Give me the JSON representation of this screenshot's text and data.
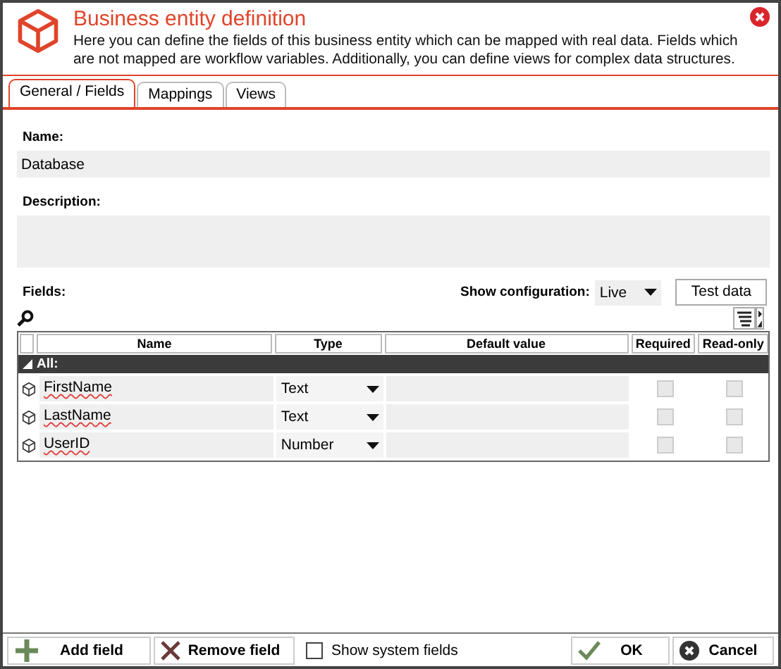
{
  "header": {
    "title": "Business entity definition",
    "description": "Here you can define the fields of this business entity which can be mapped with real data. Fields which are not mapped are workflow variables. Additionally, you can define views for complex data structures."
  },
  "tabs": [
    {
      "label": "General / Fields",
      "selected": true
    },
    {
      "label": "Mappings",
      "selected": false
    },
    {
      "label": "Views",
      "selected": false
    }
  ],
  "name": {
    "label": "Name:",
    "value": "Database"
  },
  "description": {
    "label": "Description:"
  },
  "fields": {
    "label": "Fields:",
    "config_label": "Show configuration:",
    "config_value": "Live",
    "test_button": "Test data"
  },
  "table": {
    "columns": [
      "Name",
      "Type",
      "Default value",
      "Required",
      "Read-only"
    ],
    "group": "All:",
    "group_expanded": true,
    "rows": [
      {
        "name": "FirstName",
        "type": "Text",
        "required": false,
        "read_only": false
      },
      {
        "name": "LastName",
        "type": "Text",
        "required": false,
        "read_only": false
      },
      {
        "name": "UserID",
        "type": "Number",
        "required": false,
        "read_only": false
      }
    ]
  },
  "footer": {
    "add": "Add field",
    "remove": "Remove field",
    "system_fields": {
      "label": "Show system fields",
      "checked": false
    },
    "ok": "OK",
    "cancel": "Cancel"
  }
}
